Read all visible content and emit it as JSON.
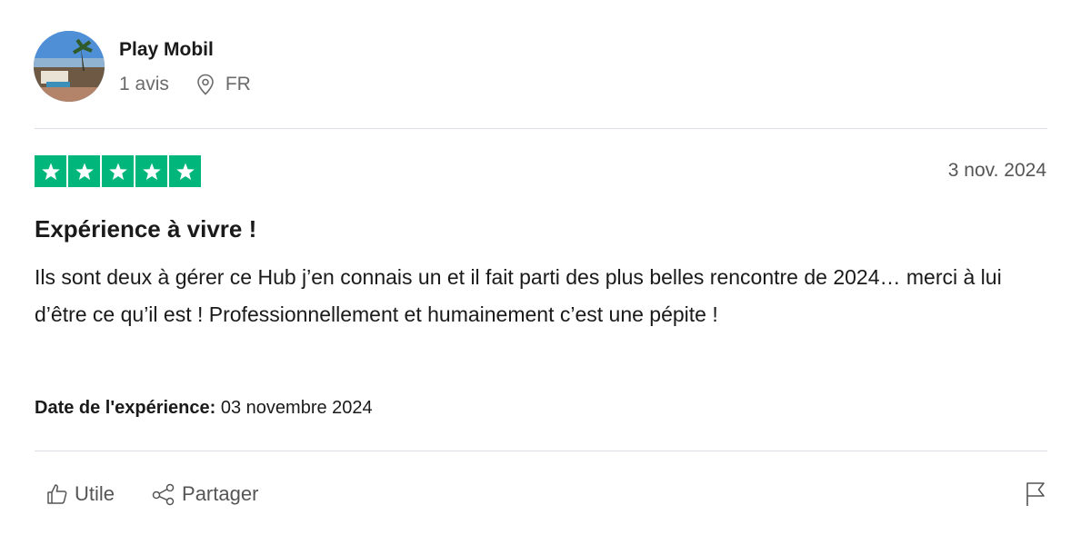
{
  "reviewer": {
    "name": "Play Mobil",
    "review_count": "1 avis",
    "country": "FR"
  },
  "review": {
    "rating": 5,
    "date": "3 nov. 2024",
    "title": "Expérience à vivre !",
    "body": "Ils sont deux à gérer ce Hub j’en connais un et il fait parti des plus belles rencontre de 2024… merci à lui d’être ce qu’il est ! Professionnellement et humainement c’est une pépite !",
    "experience_label": "Date de l'expérience:",
    "experience_date": "03 novembre 2024"
  },
  "actions": {
    "useful_label": "Utile",
    "share_label": "Partager"
  },
  "colors": {
    "star_green": "#00b67a"
  },
  "icons": [
    "location-pin-icon",
    "star-icon",
    "thumbs-up-icon",
    "share-icon",
    "flag-icon"
  ]
}
